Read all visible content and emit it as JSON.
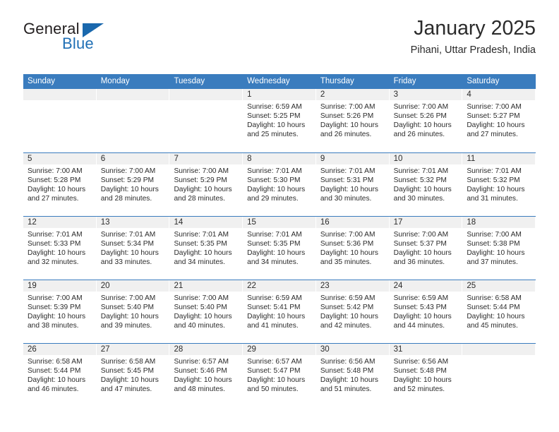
{
  "brand": {
    "name_top": "General",
    "name_bottom": "Blue",
    "accent_color": "#1a68ad"
  },
  "header": {
    "title": "January 2025",
    "subtitle": "Pihani, Uttar Pradesh, India"
  },
  "calendar": {
    "header_color": "#3a7cbe",
    "weekdays": [
      "Sunday",
      "Monday",
      "Tuesday",
      "Wednesday",
      "Thursday",
      "Friday",
      "Saturday"
    ],
    "weeks": [
      [
        {
          "day": "",
          "empty": true
        },
        {
          "day": "",
          "empty": true
        },
        {
          "day": "",
          "empty": true
        },
        {
          "day": "1",
          "sunrise": "Sunrise: 6:59 AM",
          "sunset": "Sunset: 5:25 PM",
          "daylight_line1": "Daylight: 10 hours",
          "daylight_line2": "and 25 minutes."
        },
        {
          "day": "2",
          "sunrise": "Sunrise: 7:00 AM",
          "sunset": "Sunset: 5:26 PM",
          "daylight_line1": "Daylight: 10 hours",
          "daylight_line2": "and 26 minutes."
        },
        {
          "day": "3",
          "sunrise": "Sunrise: 7:00 AM",
          "sunset": "Sunset: 5:26 PM",
          "daylight_line1": "Daylight: 10 hours",
          "daylight_line2": "and 26 minutes."
        },
        {
          "day": "4",
          "sunrise": "Sunrise: 7:00 AM",
          "sunset": "Sunset: 5:27 PM",
          "daylight_line1": "Daylight: 10 hours",
          "daylight_line2": "and 27 minutes."
        }
      ],
      [
        {
          "day": "5",
          "sunrise": "Sunrise: 7:00 AM",
          "sunset": "Sunset: 5:28 PM",
          "daylight_line1": "Daylight: 10 hours",
          "daylight_line2": "and 27 minutes."
        },
        {
          "day": "6",
          "sunrise": "Sunrise: 7:00 AM",
          "sunset": "Sunset: 5:29 PM",
          "daylight_line1": "Daylight: 10 hours",
          "daylight_line2": "and 28 minutes."
        },
        {
          "day": "7",
          "sunrise": "Sunrise: 7:00 AM",
          "sunset": "Sunset: 5:29 PM",
          "daylight_line1": "Daylight: 10 hours",
          "daylight_line2": "and 28 minutes."
        },
        {
          "day": "8",
          "sunrise": "Sunrise: 7:01 AM",
          "sunset": "Sunset: 5:30 PM",
          "daylight_line1": "Daylight: 10 hours",
          "daylight_line2": "and 29 minutes."
        },
        {
          "day": "9",
          "sunrise": "Sunrise: 7:01 AM",
          "sunset": "Sunset: 5:31 PM",
          "daylight_line1": "Daylight: 10 hours",
          "daylight_line2": "and 30 minutes."
        },
        {
          "day": "10",
          "sunrise": "Sunrise: 7:01 AM",
          "sunset": "Sunset: 5:32 PM",
          "daylight_line1": "Daylight: 10 hours",
          "daylight_line2": "and 30 minutes."
        },
        {
          "day": "11",
          "sunrise": "Sunrise: 7:01 AM",
          "sunset": "Sunset: 5:32 PM",
          "daylight_line1": "Daylight: 10 hours",
          "daylight_line2": "and 31 minutes."
        }
      ],
      [
        {
          "day": "12",
          "sunrise": "Sunrise: 7:01 AM",
          "sunset": "Sunset: 5:33 PM",
          "daylight_line1": "Daylight: 10 hours",
          "daylight_line2": "and 32 minutes."
        },
        {
          "day": "13",
          "sunrise": "Sunrise: 7:01 AM",
          "sunset": "Sunset: 5:34 PM",
          "daylight_line1": "Daylight: 10 hours",
          "daylight_line2": "and 33 minutes."
        },
        {
          "day": "14",
          "sunrise": "Sunrise: 7:01 AM",
          "sunset": "Sunset: 5:35 PM",
          "daylight_line1": "Daylight: 10 hours",
          "daylight_line2": "and 34 minutes."
        },
        {
          "day": "15",
          "sunrise": "Sunrise: 7:01 AM",
          "sunset": "Sunset: 5:35 PM",
          "daylight_line1": "Daylight: 10 hours",
          "daylight_line2": "and 34 minutes."
        },
        {
          "day": "16",
          "sunrise": "Sunrise: 7:00 AM",
          "sunset": "Sunset: 5:36 PM",
          "daylight_line1": "Daylight: 10 hours",
          "daylight_line2": "and 35 minutes."
        },
        {
          "day": "17",
          "sunrise": "Sunrise: 7:00 AM",
          "sunset": "Sunset: 5:37 PM",
          "daylight_line1": "Daylight: 10 hours",
          "daylight_line2": "and 36 minutes."
        },
        {
          "day": "18",
          "sunrise": "Sunrise: 7:00 AM",
          "sunset": "Sunset: 5:38 PM",
          "daylight_line1": "Daylight: 10 hours",
          "daylight_line2": "and 37 minutes."
        }
      ],
      [
        {
          "day": "19",
          "sunrise": "Sunrise: 7:00 AM",
          "sunset": "Sunset: 5:39 PM",
          "daylight_line1": "Daylight: 10 hours",
          "daylight_line2": "and 38 minutes."
        },
        {
          "day": "20",
          "sunrise": "Sunrise: 7:00 AM",
          "sunset": "Sunset: 5:40 PM",
          "daylight_line1": "Daylight: 10 hours",
          "daylight_line2": "and 39 minutes."
        },
        {
          "day": "21",
          "sunrise": "Sunrise: 7:00 AM",
          "sunset": "Sunset: 5:40 PM",
          "daylight_line1": "Daylight: 10 hours",
          "daylight_line2": "and 40 minutes."
        },
        {
          "day": "22",
          "sunrise": "Sunrise: 6:59 AM",
          "sunset": "Sunset: 5:41 PM",
          "daylight_line1": "Daylight: 10 hours",
          "daylight_line2": "and 41 minutes."
        },
        {
          "day": "23",
          "sunrise": "Sunrise: 6:59 AM",
          "sunset": "Sunset: 5:42 PM",
          "daylight_line1": "Daylight: 10 hours",
          "daylight_line2": "and 42 minutes."
        },
        {
          "day": "24",
          "sunrise": "Sunrise: 6:59 AM",
          "sunset": "Sunset: 5:43 PM",
          "daylight_line1": "Daylight: 10 hours",
          "daylight_line2": "and 44 minutes."
        },
        {
          "day": "25",
          "sunrise": "Sunrise: 6:58 AM",
          "sunset": "Sunset: 5:44 PM",
          "daylight_line1": "Daylight: 10 hours",
          "daylight_line2": "and 45 minutes."
        }
      ],
      [
        {
          "day": "26",
          "sunrise": "Sunrise: 6:58 AM",
          "sunset": "Sunset: 5:44 PM",
          "daylight_line1": "Daylight: 10 hours",
          "daylight_line2": "and 46 minutes."
        },
        {
          "day": "27",
          "sunrise": "Sunrise: 6:58 AM",
          "sunset": "Sunset: 5:45 PM",
          "daylight_line1": "Daylight: 10 hours",
          "daylight_line2": "and 47 minutes."
        },
        {
          "day": "28",
          "sunrise": "Sunrise: 6:57 AM",
          "sunset": "Sunset: 5:46 PM",
          "daylight_line1": "Daylight: 10 hours",
          "daylight_line2": "and 48 minutes."
        },
        {
          "day": "29",
          "sunrise": "Sunrise: 6:57 AM",
          "sunset": "Sunset: 5:47 PM",
          "daylight_line1": "Daylight: 10 hours",
          "daylight_line2": "and 50 minutes."
        },
        {
          "day": "30",
          "sunrise": "Sunrise: 6:56 AM",
          "sunset": "Sunset: 5:48 PM",
          "daylight_line1": "Daylight: 10 hours",
          "daylight_line2": "and 51 minutes."
        },
        {
          "day": "31",
          "sunrise": "Sunrise: 6:56 AM",
          "sunset": "Sunset: 5:48 PM",
          "daylight_line1": "Daylight: 10 hours",
          "daylight_line2": "and 52 minutes."
        },
        {
          "day": "",
          "empty": true
        }
      ]
    ]
  }
}
